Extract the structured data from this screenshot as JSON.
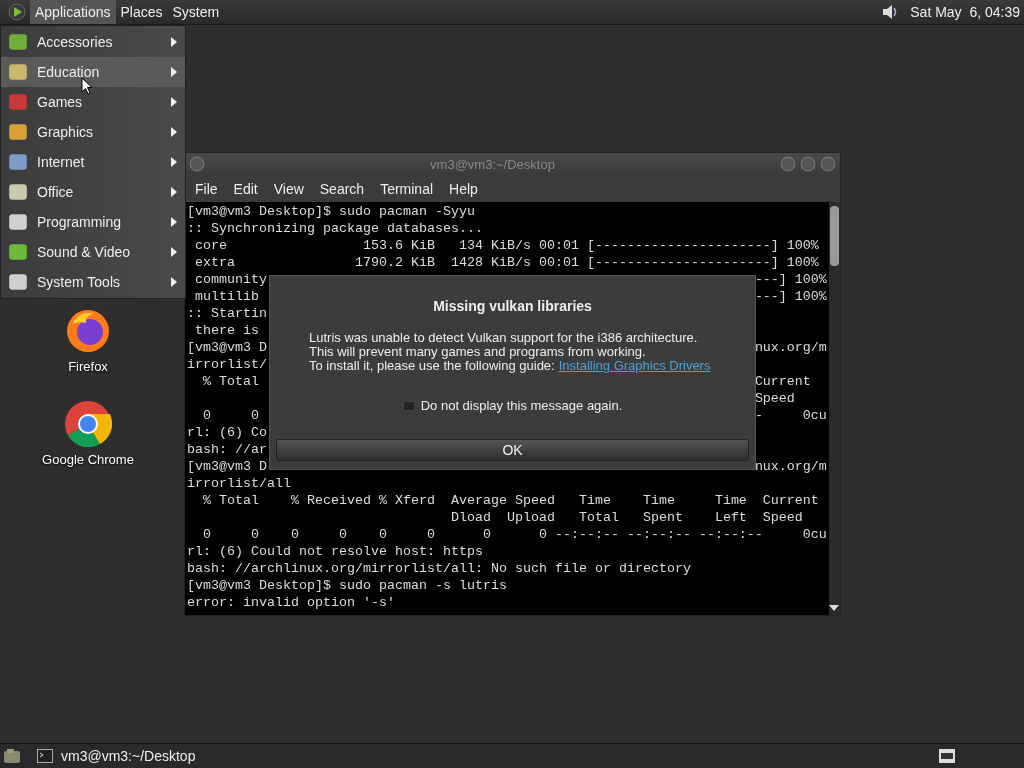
{
  "top_panel": {
    "menus": [
      {
        "label": "Applications",
        "selected": true
      },
      {
        "label": "Places",
        "selected": false
      },
      {
        "label": "System",
        "selected": false
      }
    ],
    "clock": "Sat May  6, 04:39"
  },
  "applications_menu": {
    "items": [
      {
        "label": "Accessories",
        "selected": false
      },
      {
        "label": "Education",
        "selected": true
      },
      {
        "label": "Games",
        "selected": false
      },
      {
        "label": "Graphics",
        "selected": false
      },
      {
        "label": "Internet",
        "selected": false
      },
      {
        "label": "Office",
        "selected": false
      },
      {
        "label": "Programming",
        "selected": false
      },
      {
        "label": "Sound & Video",
        "selected": false
      },
      {
        "label": "System Tools",
        "selected": false
      }
    ]
  },
  "desktop_icons": [
    {
      "label": "Firefox",
      "kind": "firefox"
    },
    {
      "label": "Google Chrome",
      "kind": "chrome"
    }
  ],
  "terminal": {
    "title": "vm3@vm3:~/Desktop",
    "menu": [
      "File",
      "Edit",
      "View",
      "Search",
      "Terminal",
      "Help"
    ],
    "lines": [
      {
        "left": "[vm3@vm3 Desktop]$ sudo pacman -Syyu"
      },
      {
        "left": ":: Synchronizing package databases..."
      },
      {
        "left": " core                 153.6 KiB   134 KiB/s 00:01 [----------------------] 100%"
      },
      {
        "left": " extra               1790.2 KiB  1428 KiB/s 00:01 [----------------------] 100%"
      },
      {
        "left": " community",
        "right": "---] 100%"
      },
      {
        "left": " multilib",
        "right": "---] 100%"
      },
      {
        "left": ":: Startin"
      },
      {
        "left": " there is"
      },
      {
        "left": "[vm3@vm3 D",
        "right": "nux.org/m"
      },
      {
        "left": "irrorlist/"
      },
      {
        "left": "  % Total",
        "right": "Current  "
      },
      {
        "right": "Speed    "
      },
      {
        "left": "  0     0",
        "right": "-     0cu"
      },
      {
        "left": "rl: (6) Co"
      },
      {
        "left": "bash: //ar"
      },
      {
        "left": "[vm3@vm3 D",
        "right": "nux.org/m"
      },
      {
        "left": "irrorlist/all"
      },
      {
        "left": "  % Total    % Received % Xferd  Average Speed   Time    Time     Time  Current"
      },
      {
        "left": "                                 Dload  Upload   Total   Spent    Left  Speed"
      },
      {
        "left": "  0     0    0     0    0     0      0      0 --:--:-- --:--:-- --:--:--     0cu"
      },
      {
        "left": "rl: (6) Could not resolve host: https"
      },
      {
        "left": "bash: //archlinux.org/mirrorlist/all: No such file or directory"
      },
      {
        "left": "[vm3@vm3 Desktop]$ sudo pacman -s lutris"
      },
      {
        "left": "error: invalid option '-s'"
      }
    ]
  },
  "dialog": {
    "title": "Missing vulkan libraries",
    "message": [
      "Lutris was unable to detect Vulkan support for the i386 architecture.",
      "This will prevent many games and programs from working.",
      "To install it, please use the following guide:"
    ],
    "link": "Installing Graphics Drivers",
    "checkbox": {
      "label": "Do not display this message again.",
      "checked": false
    },
    "button": "OK"
  },
  "taskbar": {
    "window": "vm3@vm3:~/Desktop"
  }
}
